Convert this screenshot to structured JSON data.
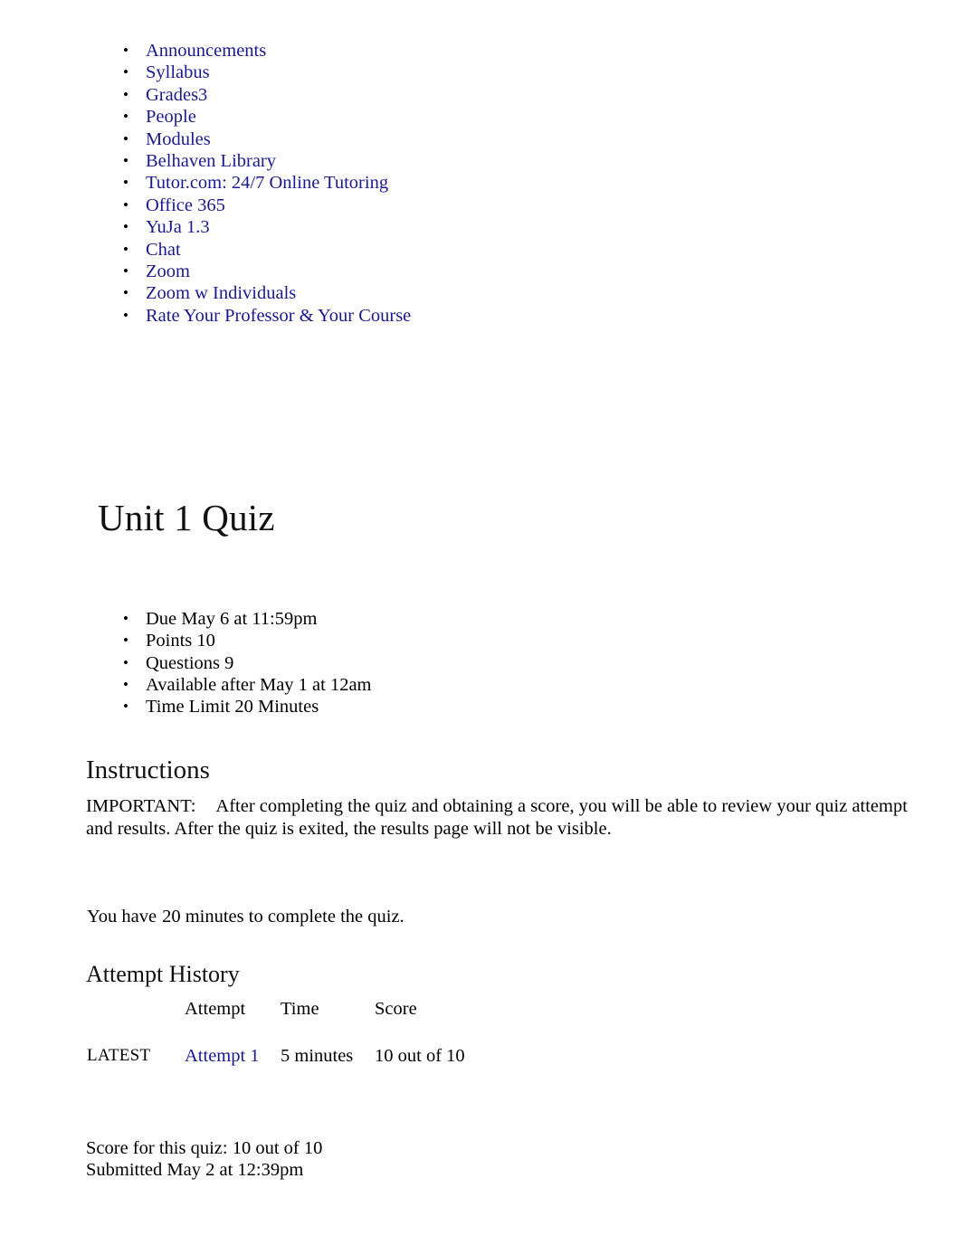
{
  "course_nav": {
    "items": [
      {
        "label": "Announcements"
      },
      {
        "label": "Syllabus"
      },
      {
        "label": "Grades3"
      },
      {
        "label": "People"
      },
      {
        "label": "Modules"
      },
      {
        "label": "Belhaven Library"
      },
      {
        "label": "Tutor.com: 24/7 Online Tutoring"
      },
      {
        "label": "Office 365"
      },
      {
        "label": "YuJa 1.3"
      },
      {
        "label": "Chat"
      },
      {
        "label": "Zoom"
      },
      {
        "label": "Zoom w Individuals"
      },
      {
        "label": "Rate Your Professor & Your Course"
      }
    ]
  },
  "quiz": {
    "title": "Unit 1 Quiz",
    "meta": [
      {
        "label": "Due May 6 at 11:59pm"
      },
      {
        "label": "Points 10"
      },
      {
        "label": "Questions 9"
      },
      {
        "label": "Available after May 1 at 12am"
      },
      {
        "label": "Time Limit 20 Minutes"
      }
    ]
  },
  "instructions": {
    "heading": "Instructions",
    "important_label": "IMPORTANT:",
    "body": "After completing the quiz and obtaining a score, you will be able to review your quiz attempt and results. After the quiz is exited, the results page will not be visible.",
    "time_note_prefix": "You have",
    "time_note_value": "20 minutes",
    "time_note_suffix": "to complete the quiz."
  },
  "attempt_history": {
    "heading": "Attempt History",
    "columns": {
      "kept": "",
      "attempt": "Attempt",
      "time": "Time",
      "score": "Score"
    },
    "rows": [
      {
        "kept": "LATEST",
        "attempt": "Attempt 1",
        "time": "5 minutes",
        "score": "10 out of 10"
      }
    ]
  },
  "result": {
    "score_line": "Score for this quiz: 10 out of 10",
    "submitted_line": "Submitted May 2 at 12:39pm"
  },
  "colors": {
    "link": "#1a1a8e",
    "text": "#000000",
    "background": "#ffffff"
  }
}
